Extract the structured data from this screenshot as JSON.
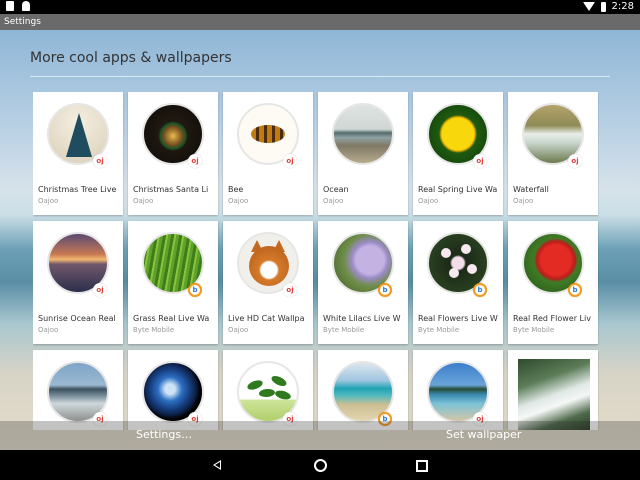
{
  "status_bar": {
    "time": "2:28"
  },
  "app_bar": {
    "title": "Settings"
  },
  "heading": "More cool apps & wallpapers",
  "tiles": [
    {
      "name": "Christmas Tree Live",
      "publisher": "Oajoo"
    },
    {
      "name": "Christmas Santa Li",
      "publisher": "Oajoo"
    },
    {
      "name": "Bee",
      "publisher": "Oajoo"
    },
    {
      "name": "Ocean",
      "publisher": "Oajoo"
    },
    {
      "name": "Real Spring Live Wa",
      "publisher": "Oajoo"
    },
    {
      "name": "Waterfall",
      "publisher": "Oajoo"
    },
    {
      "name": "Sunrise Ocean Real",
      "publisher": "Oajoo"
    },
    {
      "name": "Grass Real Live Wa",
      "publisher": "Byte Mobile"
    },
    {
      "name": "Live HD Cat Wallpa",
      "publisher": "Oajoo"
    },
    {
      "name": "White Lilacs Live W",
      "publisher": "Byte Mobile"
    },
    {
      "name": "Real Flowers Live W",
      "publisher": "Byte Mobile"
    },
    {
      "name": "Real Red Flower Liv",
      "publisher": "Byte Mobile"
    },
    {
      "name": "",
      "publisher": ""
    },
    {
      "name": "",
      "publisher": ""
    },
    {
      "name": "",
      "publisher": ""
    },
    {
      "name": "",
      "publisher": ""
    },
    {
      "name": "",
      "publisher": ""
    },
    {
      "name": "",
      "publisher": ""
    }
  ],
  "bottom_bar": {
    "settings_label": "Settings…",
    "set_wallpaper_label": "Set wallpaper"
  },
  "icons": {
    "back": "back-icon",
    "home": "home-icon",
    "recents": "recents-icon"
  }
}
